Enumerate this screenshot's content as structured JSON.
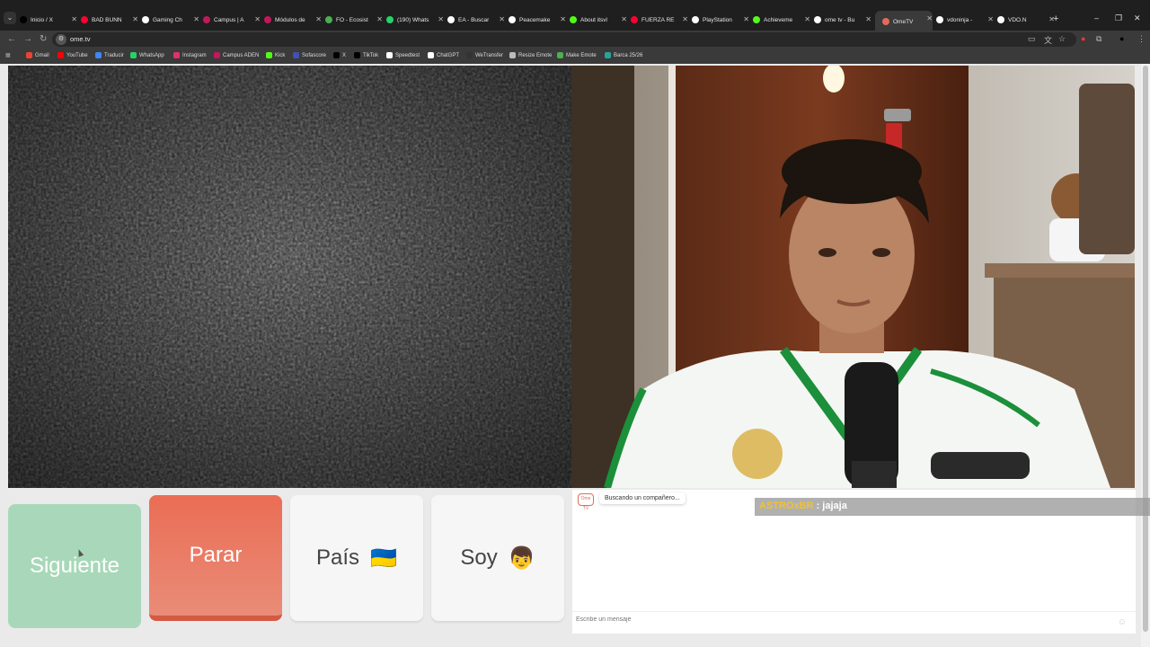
{
  "browser": {
    "tabs": [
      {
        "label": "Inicio / X",
        "color": "#000000"
      },
      {
        "label": "BAD BUNN",
        "color": "#ff0033"
      },
      {
        "label": "Gaming Ch",
        "color": "#ffffff"
      },
      {
        "label": "Campus | A",
        "color": "#c2185b"
      },
      {
        "label": "Módulos de",
        "color": "#c2185b"
      },
      {
        "label": "FO - Ecosist",
        "color": "#4caf50"
      },
      {
        "label": "(190) Whats",
        "color": "#25d366"
      },
      {
        "label": "EA - Buscar",
        "color": "#ffffff"
      },
      {
        "label": "Peacemake",
        "color": "#ffffff"
      },
      {
        "label": "About itsvl",
        "color": "#53fc18"
      },
      {
        "label": "FUERZA RE",
        "color": "#ff0033"
      },
      {
        "label": "PlayStation",
        "color": "#ffffff"
      },
      {
        "label": "Achieveme",
        "color": "#53fc18"
      },
      {
        "label": "ome tv - Bu",
        "color": "#ffffff"
      },
      {
        "label": "OmeTV",
        "color": "#e26b5a"
      },
      {
        "label": "vdoninja -",
        "color": "#ffffff"
      },
      {
        "label": "VDO.N",
        "color": "#ffffff"
      }
    ],
    "url": "ome.tv",
    "bookmarks": [
      {
        "label": "Gmail",
        "color": "#ea4335"
      },
      {
        "label": "YouTube",
        "color": "#ff0000"
      },
      {
        "label": "Traducir",
        "color": "#4285f4"
      },
      {
        "label": "WhatsApp",
        "color": "#25d366"
      },
      {
        "label": "Instagram",
        "color": "#e1306c"
      },
      {
        "label": "Campus ADEN",
        "color": "#c2185b"
      },
      {
        "label": "Kick",
        "color": "#53fc18"
      },
      {
        "label": "Sofascore",
        "color": "#3f51b5"
      },
      {
        "label": "X",
        "color": "#000000"
      },
      {
        "label": "TikTok",
        "color": "#000000"
      },
      {
        "label": "Speedtest",
        "color": "#ffffff"
      },
      {
        "label": "ChatGPT",
        "color": "#ffffff"
      },
      {
        "label": "WeTransfer",
        "color": "#333333"
      },
      {
        "label": "Resize Emote",
        "color": "#bbbbbb"
      },
      {
        "label": "Make Emote",
        "color": "#4caf50"
      },
      {
        "label": "Barca 25/26",
        "color": "#26a69a"
      }
    ]
  },
  "controls": {
    "next_label": "Siguiente",
    "stop_label": "Parar",
    "country_label": "País",
    "country_flag": "🇺🇦",
    "gender_label": "Soy",
    "gender_emoji": "👦"
  },
  "chat": {
    "logo_text": "Ome TV",
    "status": "Buscando un compañero...",
    "input_placeholder": "Escribe un mensaje"
  },
  "overlay": {
    "user": "ASTROxBR",
    "separator": " : ",
    "message": "jajaja"
  },
  "colors": {
    "next": "#a8d8b9",
    "stop": "#ea6d55",
    "accent": "#e26b5a"
  }
}
